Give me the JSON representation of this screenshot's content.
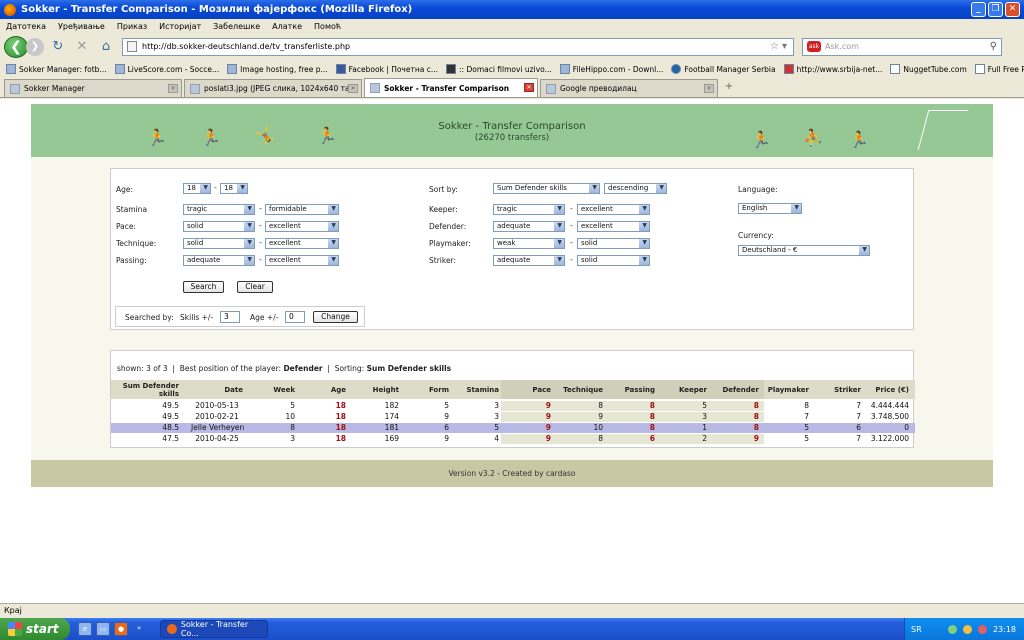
{
  "window": {
    "title": "Sokker - Transfer Comparison - Мозилин фајерфокс (Mozilla Firefox)"
  },
  "menu": [
    "Датотека",
    "Уређивање",
    "Приказ",
    "Историјат",
    "Забелешке",
    "Алатке",
    "Помоћ"
  ],
  "nav": {
    "url": "http://db.sokker-deutschland.de/tv_transferliste.php",
    "search_placeholder": "Ask.com"
  },
  "bookmarks": [
    "Sokker Manager: fotb...",
    "LiveScore.com - Socce...",
    "Image hosting, free p...",
    "Facebook | Почетна с...",
    ":: Domaci filmovi uzivo...",
    "FileHippo.com - Downl...",
    "Football Manager Serbia",
    "http://www.srbija-net...",
    "NuggetTube.com",
    "Full Free Porn Movies ..."
  ],
  "tabs": [
    {
      "label": "Sokker Manager",
      "active": false
    },
    {
      "label": "poslati3.jpg (JPEG слика, 1024x640 та...",
      "active": false
    },
    {
      "label": "Sokker - Transfer Comparison",
      "active": true
    },
    {
      "label": "Google преводилац",
      "active": false
    }
  ],
  "page": {
    "title": "Sokker - Transfer Comparison",
    "subtitle": "(26270 transfers)",
    "form": {
      "age_label": "Age:",
      "age_from": "18",
      "age_to": "18",
      "skills_left": [
        {
          "label": "Stamina",
          "from": "tragic",
          "to": "formidable"
        },
        {
          "label": "Pace:",
          "from": "solid",
          "to": "excellent"
        },
        {
          "label": "Technique:",
          "from": "solid",
          "to": "excellent"
        },
        {
          "label": "Passing:",
          "from": "adequate",
          "to": "excellent"
        }
      ],
      "sort_label": "Sort by:",
      "sort_by": "Sum Defender skills",
      "sort_dir": "descending",
      "skills_right": [
        {
          "label": "Keeper:",
          "from": "tragic",
          "to": "excellent"
        },
        {
          "label": "Defender:",
          "from": "adequate",
          "to": "excellent"
        },
        {
          "label": "Playmaker:",
          "from": "weak",
          "to": "solid"
        },
        {
          "label": "Striker:",
          "from": "adequate",
          "to": "solid"
        }
      ],
      "language_label": "Language:",
      "language": "English",
      "currency_label": "Currency:",
      "currency": "Deutschland - €",
      "search_btn": "Search",
      "clear_btn": "Clear",
      "searched_label": "Searched by:",
      "skills_pm_label": "Skills +/-",
      "skills_pm": "3",
      "age_pm_label": "Age +/-",
      "age_pm": "0",
      "change_btn": "Change"
    },
    "results": {
      "shown_label": "shown:",
      "shown_value": "3 of 3",
      "best_label": "Best position of the player:",
      "best_value": "Defender",
      "sorting_label": "Sorting:",
      "sorting_value": "Sum Defender skills",
      "headers": [
        "Sum Defender skills",
        "Date",
        "Week",
        "Age",
        "Height",
        "Form",
        "Stamina",
        "Pace",
        "Technique",
        "Passing",
        "Keeper",
        "Defender",
        "Playmaker",
        "Striker",
        "Price (€)"
      ],
      "rows": [
        {
          "sum": "49.5",
          "date": "2010-05-13",
          "week": "5",
          "age": "18",
          "height": "182",
          "form": "5",
          "stamina": "3",
          "pace": "9",
          "technique": "8",
          "passing": "8",
          "keeper": "5",
          "defender": "8",
          "playmaker": "8",
          "striker": "7",
          "price": "4.444.444",
          "hl": false
        },
        {
          "sum": "49.5",
          "date": "2010-02-21",
          "week": "10",
          "age": "18",
          "height": "174",
          "form": "9",
          "stamina": "3",
          "pace": "9",
          "technique": "9",
          "passing": "8",
          "keeper": "3",
          "defender": "8",
          "playmaker": "7",
          "striker": "7",
          "price": "3.748.500",
          "hl": false
        },
        {
          "sum": "48.5",
          "date": "Jelle Verheyen",
          "week": "8",
          "age": "18",
          "height": "181",
          "form": "6",
          "stamina": "5",
          "pace": "9",
          "technique": "10",
          "passing": "8",
          "keeper": "1",
          "defender": "8",
          "playmaker": "5",
          "striker": "6",
          "price": "0",
          "hl": true
        },
        {
          "sum": "47.5",
          "date": "2010-04-25",
          "week": "3",
          "age": "18",
          "height": "169",
          "form": "9",
          "stamina": "4",
          "pace": "9",
          "technique": "8",
          "passing": "6",
          "keeper": "2",
          "defender": "9",
          "playmaker": "5",
          "striker": "7",
          "price": "3.122.000",
          "hl": false
        }
      ]
    },
    "footer": "Version v3.2 - Created by cardaso"
  },
  "status": {
    "text": "Крај"
  },
  "taskbar": {
    "start": "start",
    "task": "Sokker - Transfer Co...",
    "lang": "SR",
    "time": "23:18"
  }
}
